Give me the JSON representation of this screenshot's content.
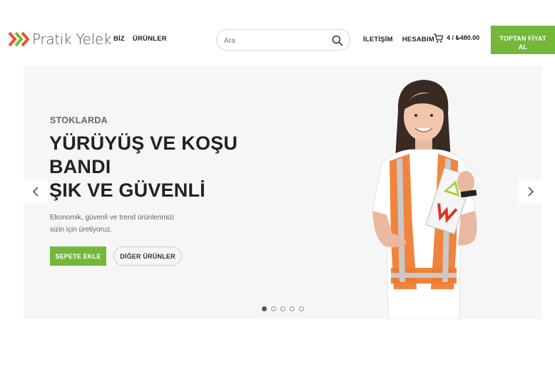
{
  "header": {
    "logo_text": "Pratik Yelek",
    "nav_left": [
      "BİZ",
      "ÜRÜNLER"
    ],
    "search_placeholder": "Ara",
    "nav_right": [
      "İLETİŞİM",
      "HESABIM"
    ],
    "cart_text": "4 / ₺480.00",
    "cta_line1": "TOPTAN FİYAT",
    "cta_line2": "AL"
  },
  "hero": {
    "eyebrow": "STOKLARDA",
    "headline_lines": [
      "YÜRÜYÜŞ VE KOŞU",
      "BANDI",
      "ŞIK VE GÜVENLİ"
    ],
    "description_lines": [
      "Ekonomik, güvenli ve trend ürünlerimizi",
      "sizin için üretiyoruz."
    ],
    "primary_button": "SEPETE EKLE",
    "secondary_button": "DİĞER ÜRÜNLER",
    "active_slide": 1,
    "slide_count": 5
  },
  "colors": {
    "brand_green": "#74b73a",
    "brand_orange": "#e8542a",
    "vest_orange": "#f07a2c"
  },
  "icons": [
    "logo-mark-icon",
    "search-icon",
    "cart-icon",
    "chevron-left-icon",
    "chevron-right-icon"
  ]
}
